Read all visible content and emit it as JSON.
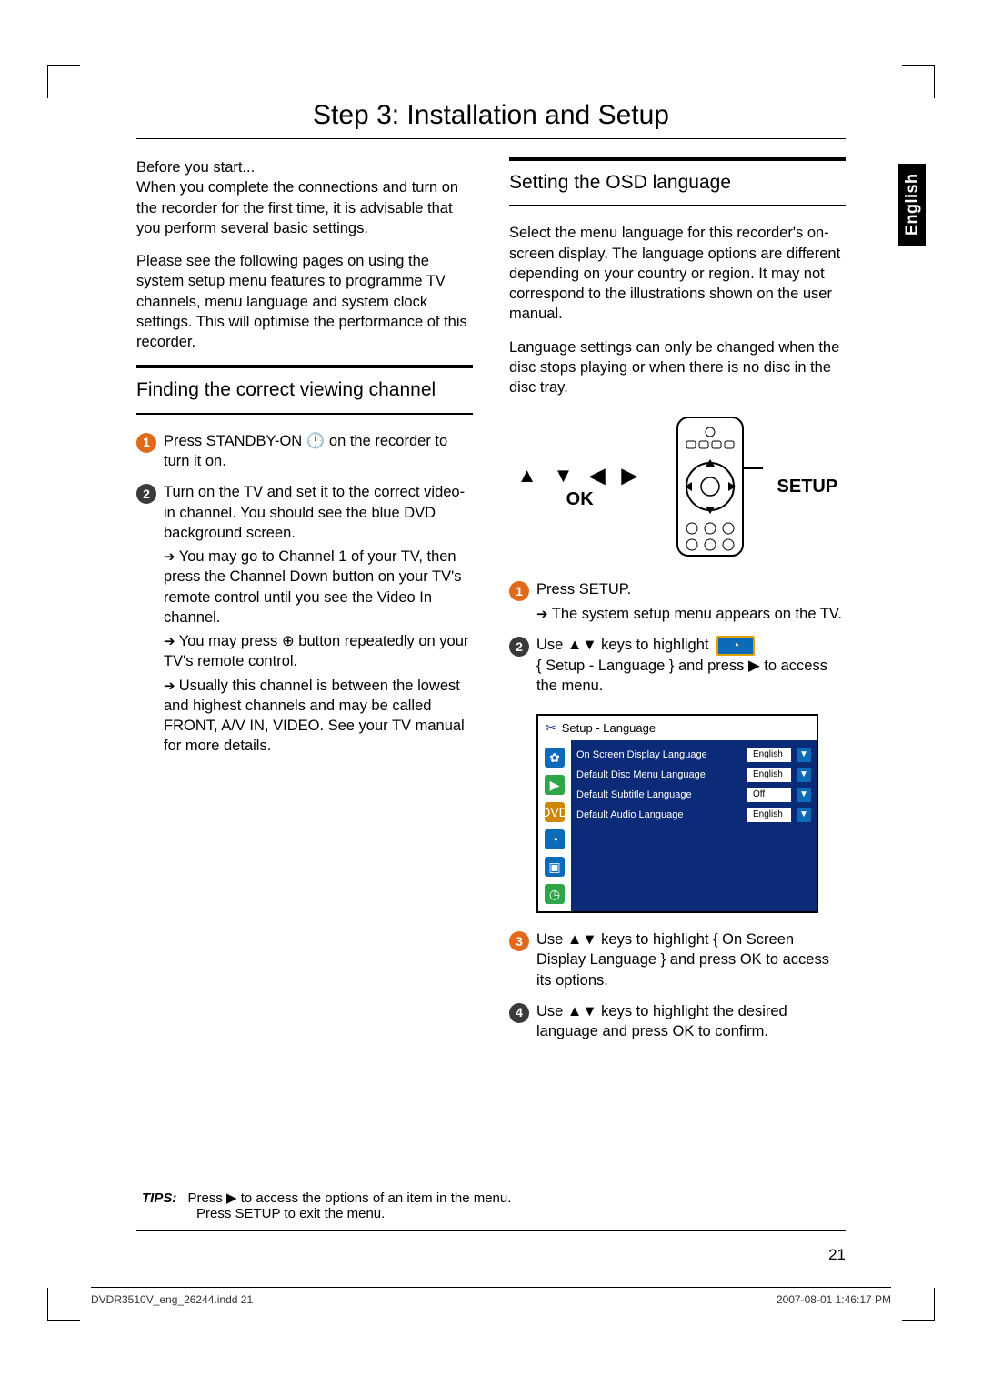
{
  "lang_tab": "English",
  "title": "Step 3: Installation and Setup",
  "left": {
    "intro1": "Before you start...\nWhen you complete the connections and turn on the recorder for the ﬁrst time, it is advisable that you perform several basic settings.",
    "intro2": "Please see the following pages on using the system setup menu features to programme TV channels, menu language and system clock settings. This will optimise the performance of this recorder.",
    "subhead": "Finding the correct viewing channel",
    "step1": "Press STANDBY-ON 🕛 on the recorder to turn it on.",
    "step2_main": "Turn on the TV and set it to the correct video-in channel. You should see the blue DVD background screen.",
    "step2_a": "You may go to Channel 1 of your TV, then press the Channel Down button on your TV's remote control until you see the Video In channel.",
    "step2_b": "You may press ⊕ button repeatedly on your TV's remote control.",
    "step2_c": "Usually this channel is between the lowest and highest channels and may be called FRONT, A/V IN, VIDEO. See your TV manual for more details."
  },
  "right": {
    "subhead": "Setting the OSD language",
    "p1": "Select the menu language for this recorder's on-screen display. The language options are different depending on your country or region. It may not correspond to the illustrations shown on the user manual.",
    "p2": "Language settings can only be changed when the disc stops playing or when there is no disc in the disc tray.",
    "remote": {
      "arrows": "▲ ▼ ◀ ▶",
      "ok": "OK",
      "setup": "SETUP"
    },
    "step1_main": "Press SETUP.",
    "step1_a": "The system setup menu appears on the TV.",
    "step2": "Use ▲▼ keys to highlight",
    "step2_tail": "{ Setup - Language } and press ▶ to access the menu.",
    "menu": {
      "title": "Setup - Language",
      "rows": [
        {
          "label": "On Screen Display Language",
          "value": "English"
        },
        {
          "label": "Default Disc Menu Language",
          "value": "English"
        },
        {
          "label": "Default Subtitle Language",
          "value": "Off"
        },
        {
          "label": "Default Audio Language",
          "value": "English"
        }
      ]
    },
    "step3": "Use ▲▼ keys to highlight { On Screen Display Language } and press OK to access its options.",
    "step4": "Use ▲▼ keys to highlight the desired language and press OK to conﬁrm."
  },
  "tips": {
    "label": "TIPS:",
    "line1": "Press ▶ to access the options of an item in the menu.",
    "line2": "Press SETUP to exit the menu."
  },
  "page_number": "21",
  "footer": {
    "left": "DVDR3510V_eng_26244.indd   21",
    "right": "2007-08-01   1:46:17 PM"
  }
}
